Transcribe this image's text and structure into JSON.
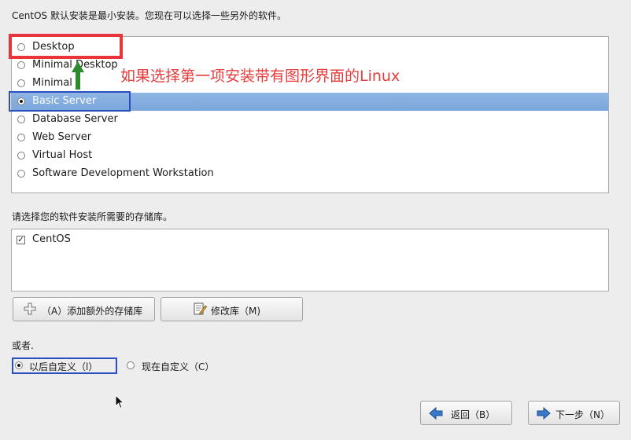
{
  "intro_text": "CentOS 默认安装是最小安装。您现在可以选择一些另外的软件。",
  "install_options": [
    {
      "label": "Desktop",
      "selected": false
    },
    {
      "label": "Minimal Desktop",
      "selected": false
    },
    {
      "label": "Minimal",
      "selected": false
    },
    {
      "label": "Basic Server",
      "selected": true
    },
    {
      "label": "Database Server",
      "selected": false
    },
    {
      "label": "Web Server",
      "selected": false
    },
    {
      "label": "Virtual Host",
      "selected": false
    },
    {
      "label": "Software Development Workstation",
      "selected": false
    }
  ],
  "annotation_text": "如果选择第一项安装带有图形界面的Linux",
  "repo_prompt": "请选择您的软件安装所需要的存储库。",
  "repositories": [
    {
      "label": "CentOS",
      "checked": true,
      "checkmark": "✓"
    }
  ],
  "buttons": {
    "add_repo": "（A）添加额外的存储库",
    "modify_repo": "修改库（M)",
    "back": "返回（B）",
    "next": "下一步（N）"
  },
  "or_label": "或者.",
  "customize_options": [
    {
      "label": "以后自定义（l）",
      "selected": true
    },
    {
      "label": "现在自定义（C）",
      "selected": false
    }
  ],
  "icons": {
    "add_repo": "plus-icon",
    "modify_repo": "edit-document-icon",
    "back": "back-arrow-icon",
    "next": "forward-arrow-icon"
  },
  "colors": {
    "selection": "#7fa9dd",
    "annotation_text": "#e53c3c",
    "highlight_red": "#e8343a",
    "highlight_blue": "#2b4fbf",
    "annotation_arrow": "#2e8a2e",
    "button_icon_blue": "#3a78c8"
  }
}
